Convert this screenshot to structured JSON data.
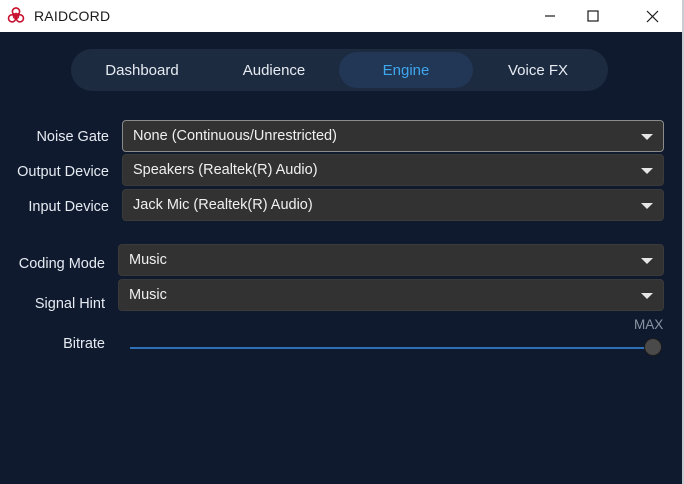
{
  "window": {
    "title": "RAIDCORD",
    "icons": {
      "logo": "biohazard-icon",
      "minimize": "minimize-icon",
      "maximize": "maximize-icon",
      "close": "close-icon"
    }
  },
  "tabs": [
    {
      "label": "Dashboard",
      "active": false
    },
    {
      "label": "Audience",
      "active": false
    },
    {
      "label": "Engine",
      "active": true
    },
    {
      "label": "Voice FX",
      "active": false
    }
  ],
  "settings": {
    "noise_gate": {
      "label": "Noise Gate",
      "value": "None (Continuous/Unrestricted)"
    },
    "output_device": {
      "label": "Output Device",
      "value": "Speakers (Realtek(R) Audio)"
    },
    "input_device": {
      "label": "Input Device",
      "value": "Jack Mic (Realtek(R) Audio)"
    },
    "coding_mode": {
      "label": "Coding Mode",
      "value": "Music"
    },
    "signal_hint": {
      "label": "Signal Hint",
      "value": "Music"
    },
    "bitrate": {
      "label": "Bitrate",
      "max_label": "MAX",
      "value_fraction": 1.0
    }
  },
  "colors": {
    "background": "#0f1a2e",
    "tab_bar": "#1d2b40",
    "tab_active_bg": "#223656",
    "tab_active_text": "#3ea7ee",
    "dropdown_bg": "#323232",
    "slider_track": "#2f6fb6"
  }
}
